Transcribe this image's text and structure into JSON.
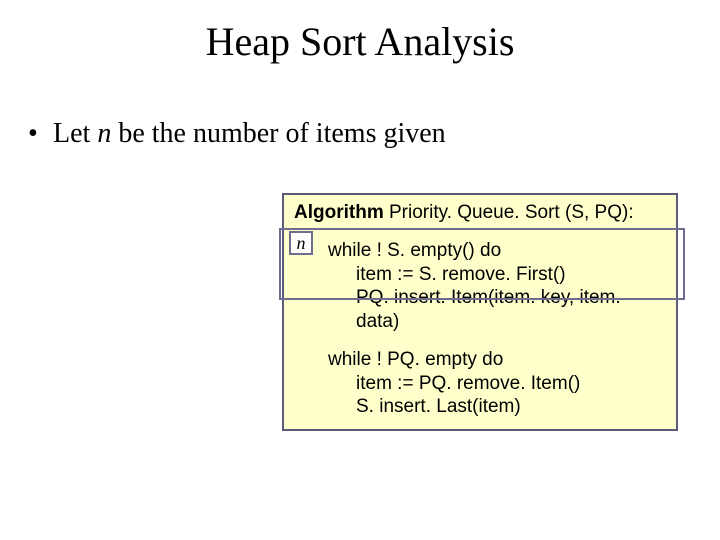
{
  "title": "Heap Sort Analysis",
  "bullet": {
    "prefix": "Let ",
    "n": "n",
    "suffix": " be the number of items given"
  },
  "algo": {
    "kw": "Algorithm",
    "signature": " Priority. Queue. Sort (S, PQ):",
    "block1": {
      "l1": "while ! S. empty() do",
      "l2": "item := S. remove. First()",
      "l3": "PQ. insert. Item(item. key, item. data)"
    },
    "block2": {
      "l1": "while ! PQ. empty do",
      "l2": "item := PQ. remove. Item()",
      "l3": "S. insert. Last(item)"
    }
  },
  "annotation": {
    "n_badge": "n"
  }
}
